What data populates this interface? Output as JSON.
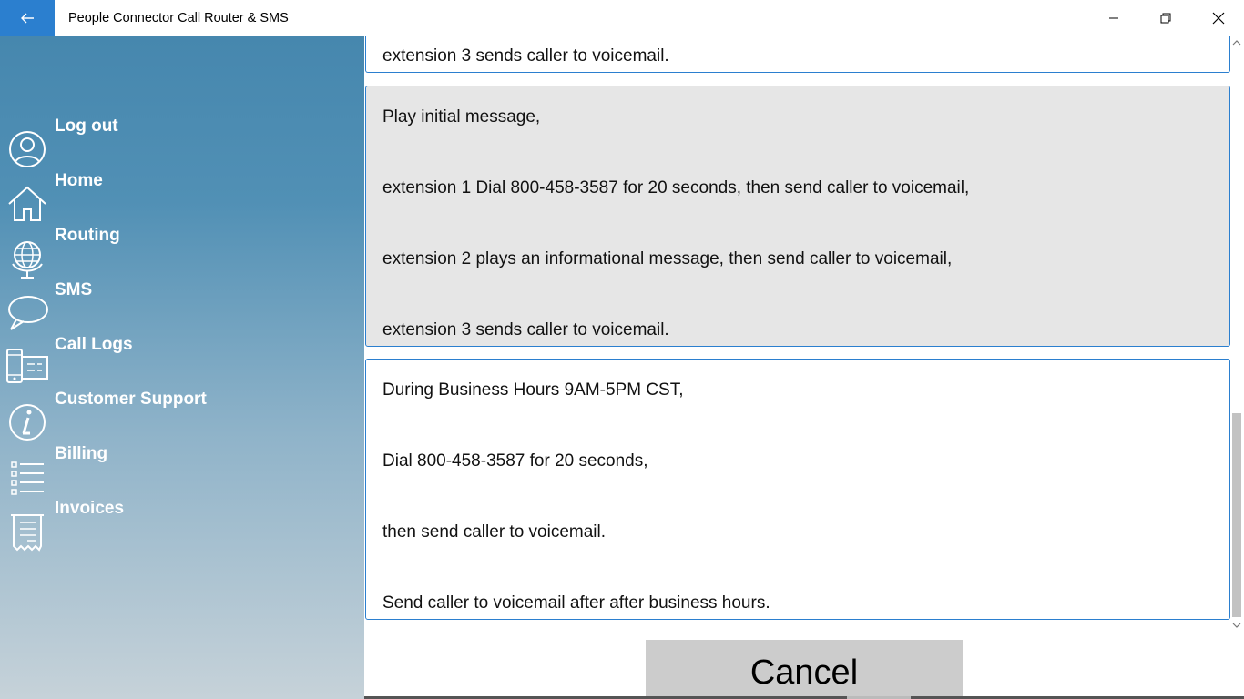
{
  "window": {
    "title": "People Connector Call Router & SMS",
    "accent_color": "#2b7fcf"
  },
  "sidebar": {
    "items": [
      {
        "label": "Log out",
        "icon": "user-icon"
      },
      {
        "label": "Home",
        "icon": "home-icon"
      },
      {
        "label": "Routing",
        "icon": "globe-icon"
      },
      {
        "label": "SMS",
        "icon": "chat-bubble-icon"
      },
      {
        "label": "Call Logs",
        "icon": "phone-list-icon"
      },
      {
        "label": "Customer Support",
        "icon": "info-icon"
      },
      {
        "label": "Billing",
        "icon": "list-icon"
      },
      {
        "label": "Invoices",
        "icon": "receipt-icon"
      }
    ]
  },
  "routing_options": [
    {
      "lines": [
        "extension 3 sends caller to voicemail."
      ]
    },
    {
      "selected": true,
      "lines": [
        "Play initial message,",
        "extension 1 Dial 800-458-3587 for 20 seconds, then send caller to voicemail,",
        "extension 2 plays an informational message, then send caller to voicemail,",
        "extension 3 sends caller to voicemail."
      ]
    },
    {
      "lines": [
        "During Business Hours 9AM-5PM CST,",
        "Dial 800-458-3587 for 20 seconds,",
        "then send caller to voicemail.",
        "Send caller to voicemail after after business hours."
      ]
    }
  ],
  "actions": {
    "cancel_label": "Cancel"
  }
}
